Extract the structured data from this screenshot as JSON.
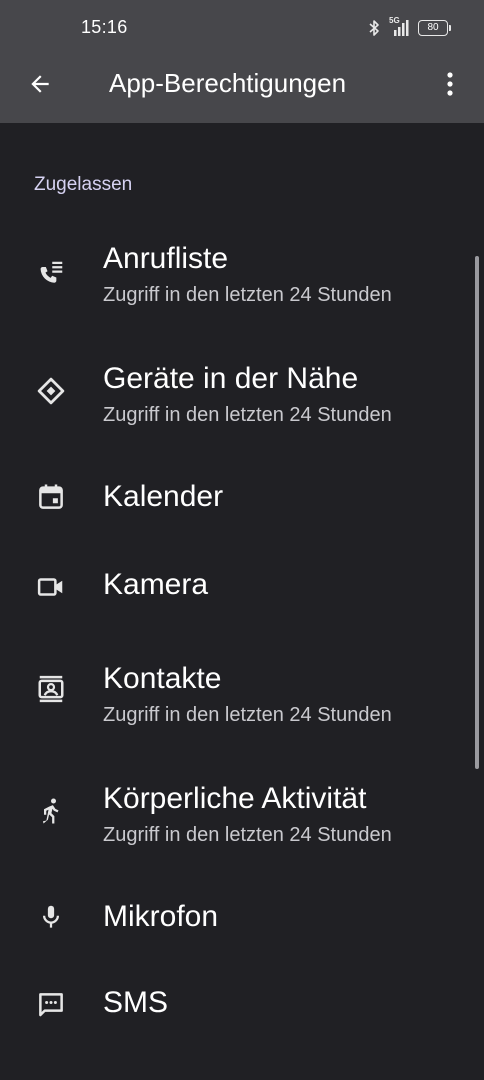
{
  "status_bar": {
    "time": "15:16",
    "network": "5G",
    "battery": "80",
    "icons": [
      "bluetooth-icon",
      "signal-icon",
      "battery-icon"
    ]
  },
  "app_bar": {
    "title": "App-Berechtigungen",
    "back_icon": "arrow-back-icon",
    "menu_icon": "more-vert-icon"
  },
  "section": {
    "header": "Zugelassen"
  },
  "permissions": [
    {
      "label": "Anrufliste",
      "summary": "Zugriff in den letzten 24 Stunden",
      "icon": "call-log-icon"
    },
    {
      "label": "Geräte in der Nähe",
      "summary": "Zugriff in den letzten 24 Stunden",
      "icon": "nearby-devices-icon"
    },
    {
      "label": "Kalender",
      "summary": "",
      "icon": "calendar-icon"
    },
    {
      "label": "Kamera",
      "summary": "",
      "icon": "camera-icon"
    },
    {
      "label": "Kontakte",
      "summary": "Zugriff in den letzten 24 Stunden",
      "icon": "contacts-icon"
    },
    {
      "label": "Körperliche Aktivität",
      "summary": "Zugriff in den letzten 24 Stunden",
      "icon": "physical-activity-icon"
    },
    {
      "label": "Mikrofon",
      "summary": "",
      "icon": "microphone-icon"
    },
    {
      "label": "SMS",
      "summary": "",
      "icon": "sms-icon"
    }
  ],
  "colors": {
    "background": "#202024",
    "top_bar": "#47474b",
    "section_header": "#d6d2f2",
    "summary_text": "#c9c9ce"
  }
}
